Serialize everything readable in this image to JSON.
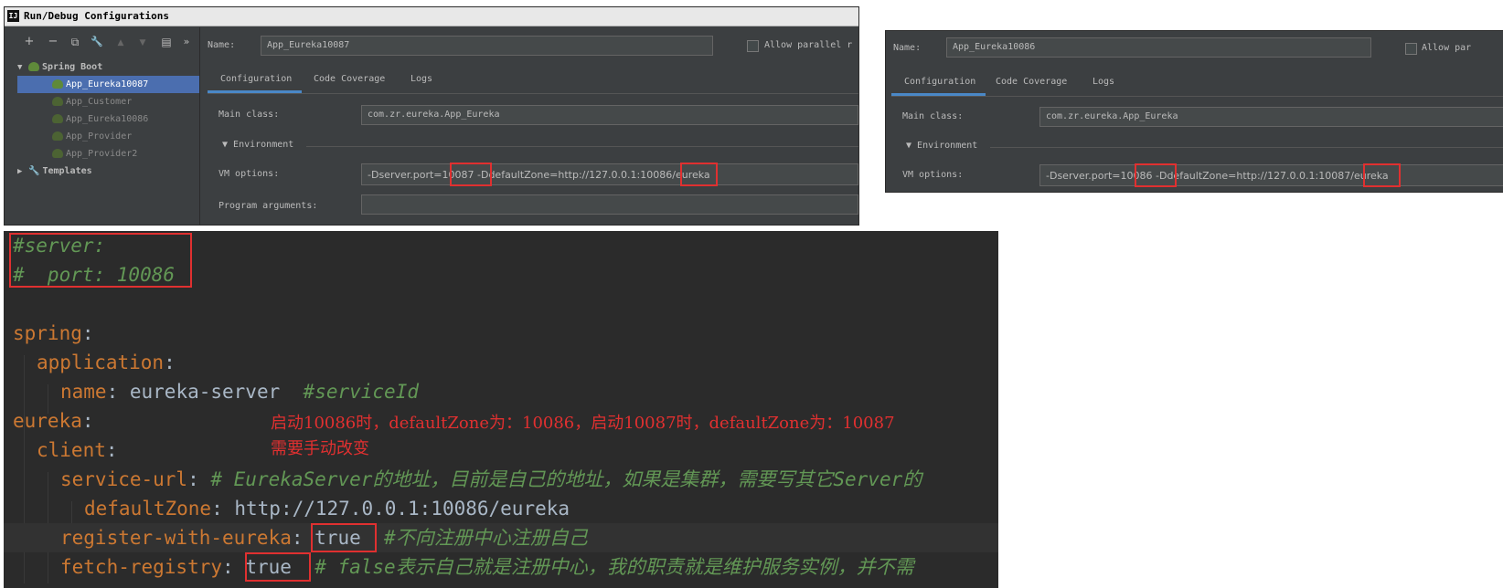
{
  "dialog1": {
    "title": "Run/Debug Configurations",
    "logo_text": "IJ",
    "toolbar": {
      "add": "+",
      "remove": "−",
      "copy": "⧉",
      "edit": "🔧",
      "up": "▲",
      "down": "▼",
      "folder": "▤",
      "more": "»"
    },
    "tree": {
      "group": "Spring Boot",
      "items": [
        "App_Eureka10087",
        "App_Customer",
        "App_Eureka10086",
        "App_Provider",
        "App_Provider2"
      ],
      "templates": "Templates"
    },
    "name_label": "Name:",
    "name_value": "App_Eureka10087",
    "allow_parallel": "Allow parallel r",
    "tabs": [
      "Configuration",
      "Code Coverage",
      "Logs"
    ],
    "main_class_label": "Main class:",
    "main_class_value": "com.zr.eureka.App_Eureka",
    "environment_label": "Environment",
    "vm_options_label": "VM options:",
    "vm_options_value": "-Dserver.port=10087 -DdefaultZone=http://127.0.0.1:10086/eureka",
    "program_args_label": "Program arguments:",
    "program_args_value": ""
  },
  "dialog2": {
    "name_label": "Name:",
    "name_value": "App_Eureka10086",
    "allow_parallel": "Allow par",
    "tabs": [
      "Configuration",
      "Code Coverage",
      "Logs"
    ],
    "main_class_label": "Main class:",
    "main_class_value": "com.zr.eureka.App_Eureka",
    "environment_label": "Environment",
    "vm_options_label": "VM options:",
    "vm_options_value": "-Dserver.port=10086 -DdefaultZone=http://127.0.0.1:10087/eureka"
  },
  "editor": {
    "lines": {
      "l1": "#server:",
      "l2": "#  port: 10086",
      "l4_key": "spring",
      "l5_key": "application",
      "l6_key": "name",
      "l6_val": "eureka-server",
      "l6_com": "#serviceId",
      "l7_key": "eureka",
      "l8_key": "client",
      "l9_key": "service-url",
      "l9_com": "# EurekaServer的地址，目前是自己的地址，如果是集群，需要写其它Server的",
      "l10_key": "defaultZone",
      "l10_val": "http://127.0.0.1:10086/eureka",
      "l11_key": "register-with-eureka",
      "l11_val": "true",
      "l11_com": "#不向注册中心注册自己",
      "l12_key": "fetch-registry",
      "l12_val": "true",
      "l12_com": "# false表示自己就是注册中心，我的职责就是维护服务实例，并不需"
    },
    "note_line1": "启动10086时，defaultZone为：10086，启动10087时，defaultZone为：10087",
    "note_line2": "需要手动改变"
  }
}
